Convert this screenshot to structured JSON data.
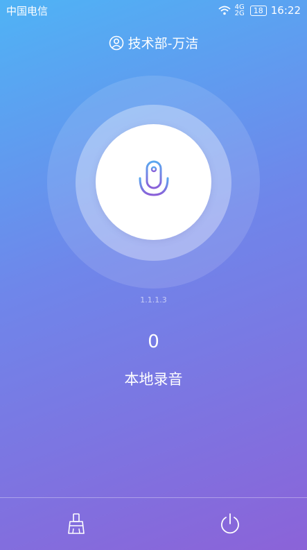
{
  "status_bar": {
    "carrier": "中国电信",
    "network": "4G",
    "network_alt": "2G",
    "battery": "18",
    "time": "16:22"
  },
  "header": {
    "user_name": "技术部-万洁"
  },
  "version": "1.1.1.3",
  "recording": {
    "count": "0",
    "mode_label": "本地录音"
  },
  "icons": {
    "user": "user-icon",
    "mic": "microphone-icon",
    "clean": "broom-icon",
    "power": "power-icon"
  },
  "colors": {
    "gradient_start": "#4fb3f5",
    "gradient_end": "#8b63d8",
    "mic_gradient_top": "#5aa8f0",
    "mic_gradient_bottom": "#8a5ed8"
  }
}
